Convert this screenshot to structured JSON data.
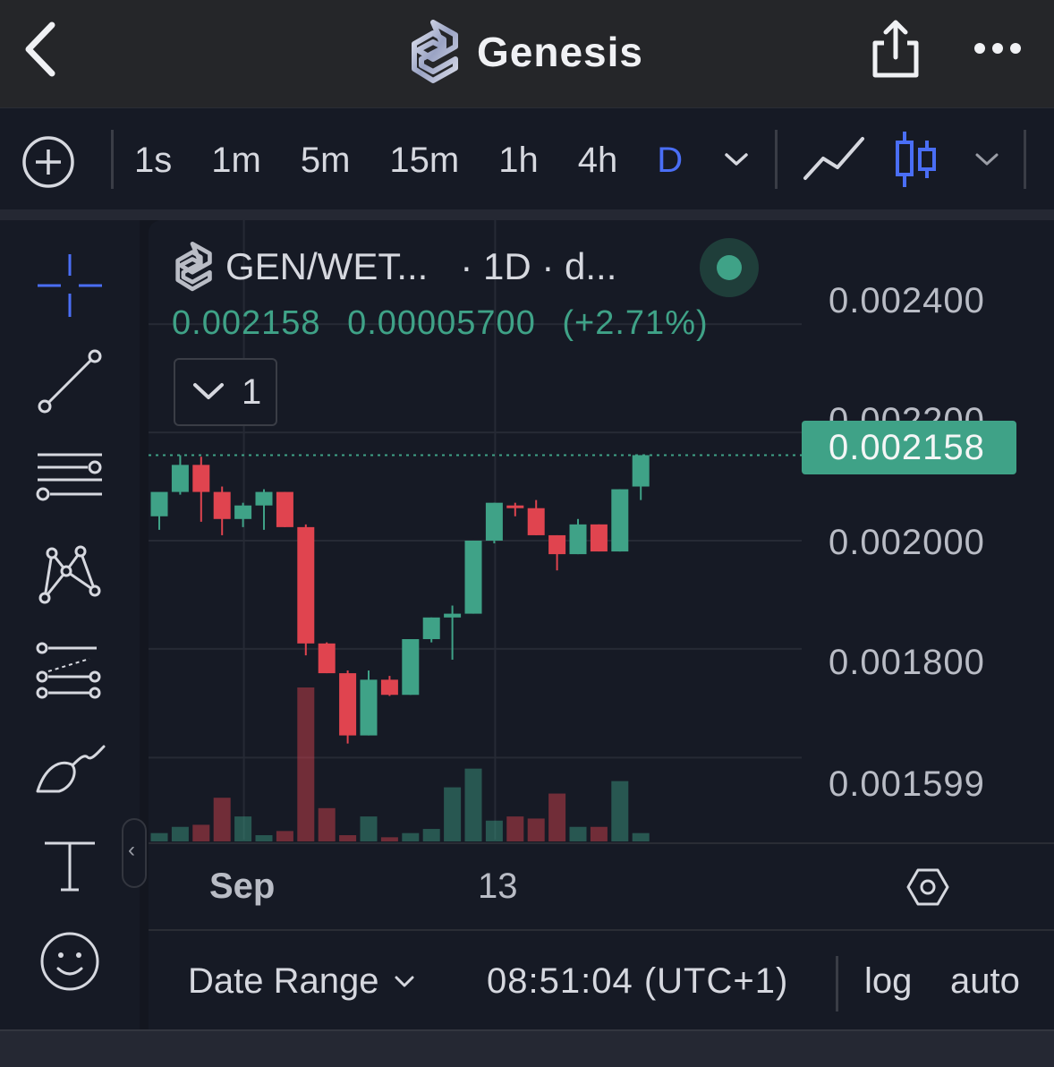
{
  "header": {
    "title": "Genesis",
    "back_icon": "chevron-left-icon",
    "share_icon": "share-icon",
    "more_icon": "more-horizontal-icon"
  },
  "toolbar": {
    "add_icon": "plus-circle-icon",
    "intervals": [
      "1s",
      "1m",
      "5m",
      "15m",
      "1h",
      "4h",
      "D"
    ],
    "active_interval": "D",
    "line_chart_icon": "line-chart-icon",
    "candles_icon": "candlestick-icon"
  },
  "drawing_tools": [
    "crosshair-icon",
    "trend-line-icon",
    "horizontal-lines-icon",
    "pattern-icon",
    "prediction-icon",
    "brush-icon",
    "text-icon",
    "emoji-icon"
  ],
  "legend": {
    "symbol": "GEN/WET...",
    "interval_info": "· 1D · d...",
    "price": "0.002158",
    "change": "0.00005700",
    "change_pct": "(+2.71%)",
    "indicator_count": "1"
  },
  "price_axis": {
    "labels": [
      "0.002400",
      "0.002200",
      "0.002000",
      "0.001800",
      "0.001599"
    ],
    "last_price": "0.002158"
  },
  "time_axis": {
    "labels": [
      "Sep",
      "13"
    ]
  },
  "bottom_bar": {
    "date_range": "Date Range",
    "time": "08:51:04 (UTC+1)",
    "log": "log",
    "auto": "auto"
  },
  "colors": {
    "up": "#3fa287",
    "down": "#e0444f",
    "accent": "#4a6ef5",
    "background": "#161a25"
  },
  "chart_data": {
    "type": "candlestick",
    "ylim": [
      0.00155,
      0.00244
    ],
    "last_price": 0.002158,
    "candles": [
      {
        "o": 0.002045,
        "h": 0.00206,
        "l": 0.00202,
        "c": 0.00209
      },
      {
        "o": 0.00209,
        "h": 0.002158,
        "l": 0.002085,
        "c": 0.00214
      },
      {
        "o": 0.00214,
        "h": 0.002155,
        "l": 0.002035,
        "c": 0.00209
      },
      {
        "o": 0.00209,
        "h": 0.0021,
        "l": 0.00201,
        "c": 0.00204
      },
      {
        "o": 0.00204,
        "h": 0.00207,
        "l": 0.002025,
        "c": 0.002065
      },
      {
        "o": 0.002065,
        "h": 0.002095,
        "l": 0.00202,
        "c": 0.00209
      },
      {
        "o": 0.00209,
        "h": 0.00209,
        "l": 0.002025,
        "c": 0.002025
      },
      {
        "o": 0.002025,
        "h": 0.00203,
        "l": 0.001788,
        "c": 0.00181
      },
      {
        "o": 0.00181,
        "h": 0.001812,
        "l": 0.001755,
        "c": 0.001755
      },
      {
        "o": 0.001755,
        "h": 0.00176,
        "l": 0.001625,
        "c": 0.00164
      },
      {
        "o": 0.00164,
        "h": 0.00176,
        "l": 0.00164,
        "c": 0.001743
      },
      {
        "o": 0.001743,
        "h": 0.00175,
        "l": 0.001713,
        "c": 0.001715
      },
      {
        "o": 0.001715,
        "h": 0.001818,
        "l": 0.001715,
        "c": 0.001818
      },
      {
        "o": 0.001818,
        "h": 0.001858,
        "l": 0.001812,
        "c": 0.001858
      },
      {
        "o": 0.001858,
        "h": 0.00188,
        "l": 0.00178,
        "c": 0.001865
      },
      {
        "o": 0.001865,
        "h": 0.002,
        "l": 0.001865,
        "c": 0.002
      },
      {
        "o": 0.002,
        "h": 0.00207,
        "l": 0.001995,
        "c": 0.00207
      },
      {
        "o": 0.002065,
        "h": 0.00207,
        "l": 0.002045,
        "c": 0.00206
      },
      {
        "o": 0.00206,
        "h": 0.002075,
        "l": 0.00201,
        "c": 0.00201
      },
      {
        "o": 0.00201,
        "h": 0.00201,
        "l": 0.001945,
        "c": 0.001975
      },
      {
        "o": 0.001975,
        "h": 0.00204,
        "l": 0.001975,
        "c": 0.00203
      },
      {
        "o": 0.00203,
        "h": 0.00203,
        "l": 0.00198,
        "c": 0.00198
      },
      {
        "o": 0.00198,
        "h": 0.002095,
        "l": 0.00198,
        "c": 0.002095
      },
      {
        "o": 0.0021,
        "h": 0.002158,
        "l": 0.002075,
        "c": 0.002158
      }
    ],
    "volumes": [
      8,
      14,
      16,
      42,
      24,
      6,
      10,
      148,
      32,
      6,
      24,
      4,
      8,
      12,
      52,
      70,
      20,
      24,
      22,
      46,
      14,
      14,
      58,
      8
    ],
    "x_labels": [
      {
        "index": 4,
        "label": "Sep"
      },
      {
        "index": 16,
        "label": "13"
      }
    ]
  }
}
